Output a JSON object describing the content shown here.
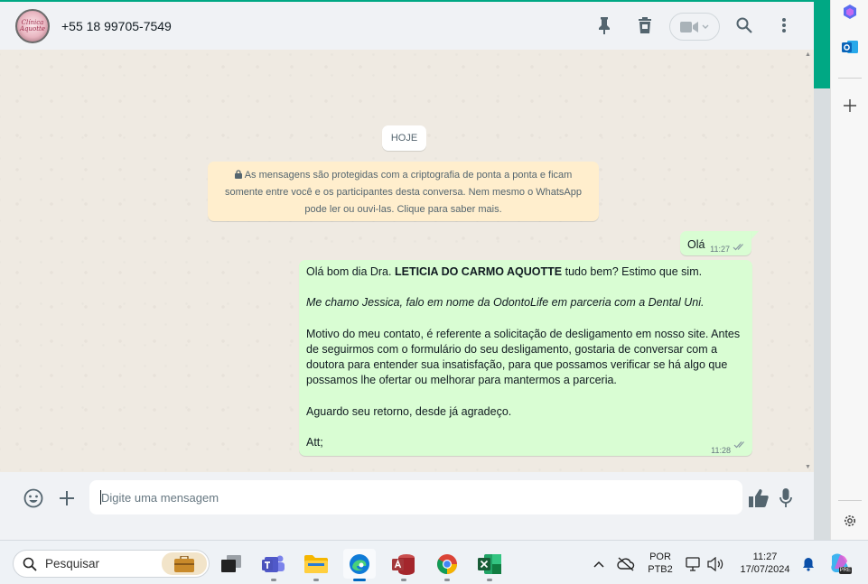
{
  "header": {
    "avatar_logo_line1": "Clínica",
    "avatar_logo_line2": "Aquotte",
    "contact_name": "+55 18 99705-7549"
  },
  "chat": {
    "day_label": "HOJE",
    "e2e_notice": "As mensagens são protegidas com a criptografia de ponta a ponta e ficam somente entre você e os participantes desta conversa. Nem mesmo o WhatsApp pode ler ou ouvi-las. Clique para saber mais.",
    "messages": [
      {
        "text": "Olá",
        "time": "11:27"
      },
      {
        "greeting_pre": "Olá bom dia Dra. ",
        "greeting_bold": "LETICIA DO CARMO AQUOTTE",
        "greeting_post": " tudo bem? Estimo que sim.",
        "intro_italic": "Me chamo Jessica, falo em nome da OdontoLife em parceria com a Dental Uni.",
        "body": "Motivo do meu contato, é referente a solicitação de desligamento em nosso site. Antes de seguirmos com o formulário do seu desligamento, gostaria de conversar com a doutora para entender sua insatisfação, para que possamos verificar se há algo que possamos lhe ofertar ou melhorar para mantermos a parceria.",
        "closing": "Aguardo seu retorno, desde já agradeço.",
        "signoff": "Att;",
        "time": "11:28"
      }
    ]
  },
  "composer": {
    "placeholder": "Digite uma mensagem"
  },
  "taskbar": {
    "search_label": "Pesquisar",
    "language_line1": "POR",
    "language_line2": "PTB2",
    "clock_time": "11:27",
    "clock_date": "17/07/2024",
    "copilot_badge": "PRE"
  },
  "colors": {
    "whatsapp_green": "#00a884",
    "bubble_out": "#d9fdd3",
    "notice_bg": "#ffeecd",
    "read_ticks": "#8696a0"
  }
}
